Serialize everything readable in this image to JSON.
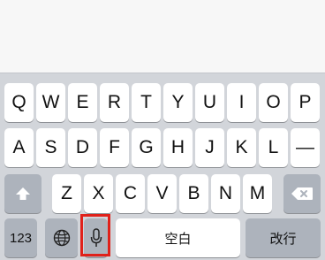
{
  "keyboard": {
    "row1": [
      "Q",
      "W",
      "E",
      "R",
      "T",
      "Y",
      "U",
      "I",
      "O",
      "P"
    ],
    "row2": [
      "A",
      "S",
      "D",
      "F",
      "G",
      "H",
      "J",
      "K",
      "L",
      "—"
    ],
    "row3": [
      "Z",
      "X",
      "C",
      "V",
      "B",
      "N",
      "M"
    ],
    "bottom": {
      "numbers_label": "123",
      "space_label": "空白",
      "return_label": "改行"
    }
  },
  "highlight": {
    "target": "mic-key",
    "color": "#e0211a"
  }
}
